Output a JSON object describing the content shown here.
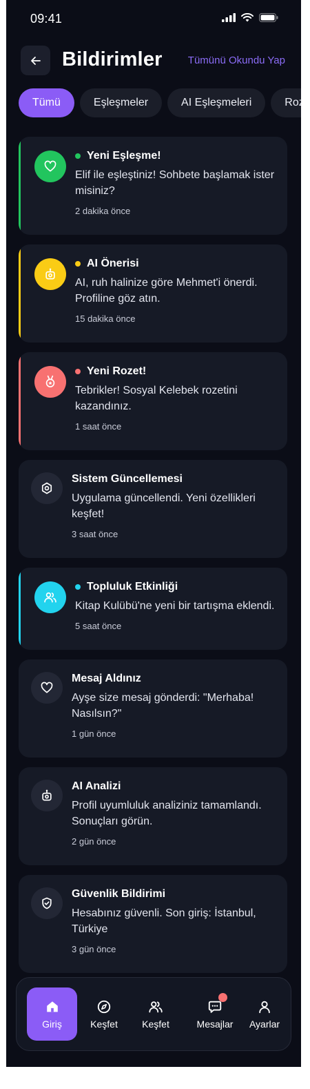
{
  "status": {
    "time": "09:41"
  },
  "header": {
    "title": "Bildirimler",
    "mark_all": "Tümünü Okundu Yap"
  },
  "tabs": [
    {
      "label": "Tümü"
    },
    {
      "label": "Eşleşmeler"
    },
    {
      "label": "AI Eşleşmeleri"
    },
    {
      "label": "Rozetler"
    }
  ],
  "notifications": [
    {
      "title": "Yeni Eşleşme!",
      "text": "Elif ile eşleştiniz! Sohbete başlamak ister misiniz?",
      "time": "2 dakika önce",
      "accent": "#22c55e",
      "icon": "heart-icon"
    },
    {
      "title": "AI Önerisi",
      "text": "AI, ruh halinize göre Mehmet'i önerdi. Profiline göz atın.",
      "time": "15 dakika önce",
      "accent": "#facc15",
      "icon": "robot-icon"
    },
    {
      "title": "Yeni Rozet!",
      "text": "Tebrikler! Sosyal Kelebek rozetini kazandınız.",
      "time": "1 saat önce",
      "accent": "#f87171",
      "icon": "medal-icon"
    },
    {
      "title": "Sistem Güncellemesi",
      "text": "Uygulama güncellendi. Yeni özellikleri keşfet!",
      "time": "3 saat önce",
      "icon": "settings-icon"
    },
    {
      "title": "Topluluk Etkinliği",
      "text": "Kitap Kulübü'ne yeni bir tartışma eklendi.",
      "time": "5 saat önce",
      "accent": "#22d3ee",
      "icon": "users-icon"
    },
    {
      "title": "Mesaj Aldınız",
      "text": "Ayşe size mesaj gönderdi: \"Merhaba! Nasılsın?\"",
      "time": "1 gün önce",
      "icon": "heart-icon"
    },
    {
      "title": "AI Analizi",
      "text": "Profil uyumluluk analiziniz tamamlandı. Sonuçları görün.",
      "time": "2 gün önce",
      "icon": "robot-icon"
    },
    {
      "title": "Güvenlik Bildirimi",
      "text": "Hesabınız güvenli. Son giriş: İstanbul, Türkiye",
      "time": "3 gün önce",
      "icon": "shield-icon"
    }
  ],
  "nav": [
    {
      "label": "Giriş",
      "icon": "home-icon"
    },
    {
      "label": "Keşfet",
      "icon": "compass-icon"
    },
    {
      "label": "Keşfet",
      "icon": "users-icon"
    },
    {
      "label": "Mesajlar",
      "icon": "chat-icon"
    },
    {
      "label": "Ayarlar",
      "icon": "user-icon"
    }
  ],
  "colors": {
    "primary": "#8b5cf6",
    "background": "#0b0d17",
    "card": "#161a26",
    "badge": "#f87171"
  }
}
